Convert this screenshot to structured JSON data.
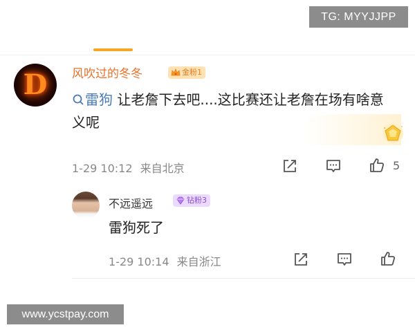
{
  "watermarks": {
    "top": "TG: MYYJJPP",
    "bottom": "www.ycstpay.com"
  },
  "comment": {
    "username": "风吹过的冬冬",
    "badge": "金粉1",
    "mention": "雷狗",
    "text": " 让老詹下去吧....这比赛还让老詹在场有啥意义呢",
    "time": "1-29 10:12",
    "location": "来自北京",
    "like_count": "5"
  },
  "reply": {
    "username": "不远遥远",
    "badge": "钻粉3",
    "text": "雷狗死了",
    "time": "1-29 10:14",
    "location": "来自浙江"
  },
  "icons": [
    "share-icon",
    "comment-icon",
    "like-icon",
    "search-icon",
    "crown-icon",
    "diamond-icon",
    "gold-gem-icon"
  ],
  "colors": {
    "accent": "#f5a623",
    "username": "#e8722a",
    "link": "#4a7bb7",
    "meta": "#888888"
  }
}
